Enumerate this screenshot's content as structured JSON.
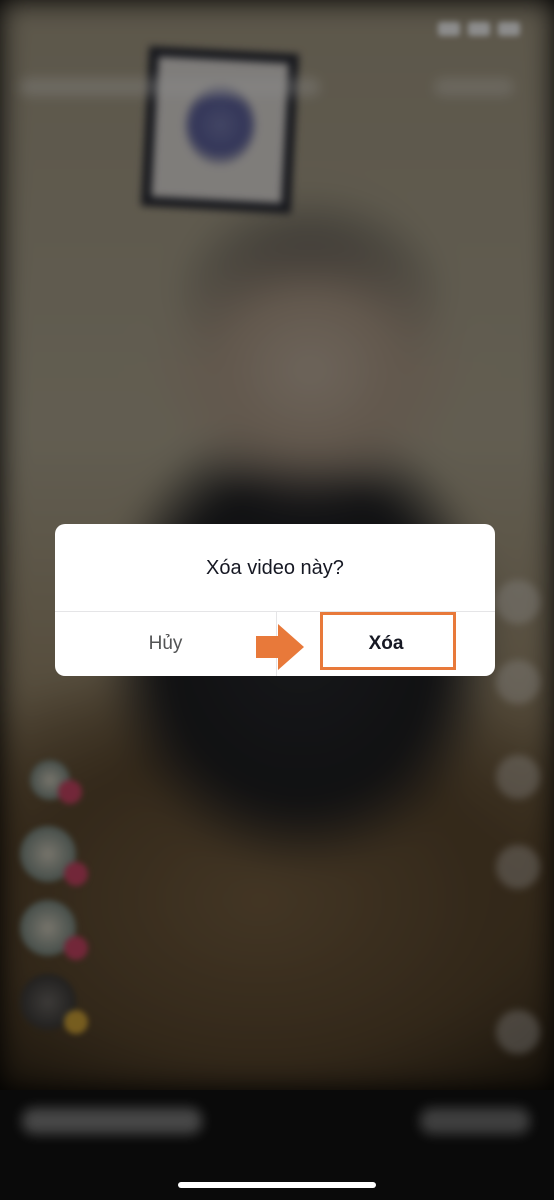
{
  "dialog": {
    "title": "Xóa video này?",
    "cancel_label": "Hủy",
    "delete_label": "Xóa"
  },
  "colors": {
    "highlight": "#e8793a",
    "dialog_background": "#ffffff",
    "title_text": "#161823",
    "cancel_text": "#535455"
  },
  "annotations": {
    "arrow_icon": "right-arrow-icon",
    "highlight": "delete-button-highlight"
  }
}
